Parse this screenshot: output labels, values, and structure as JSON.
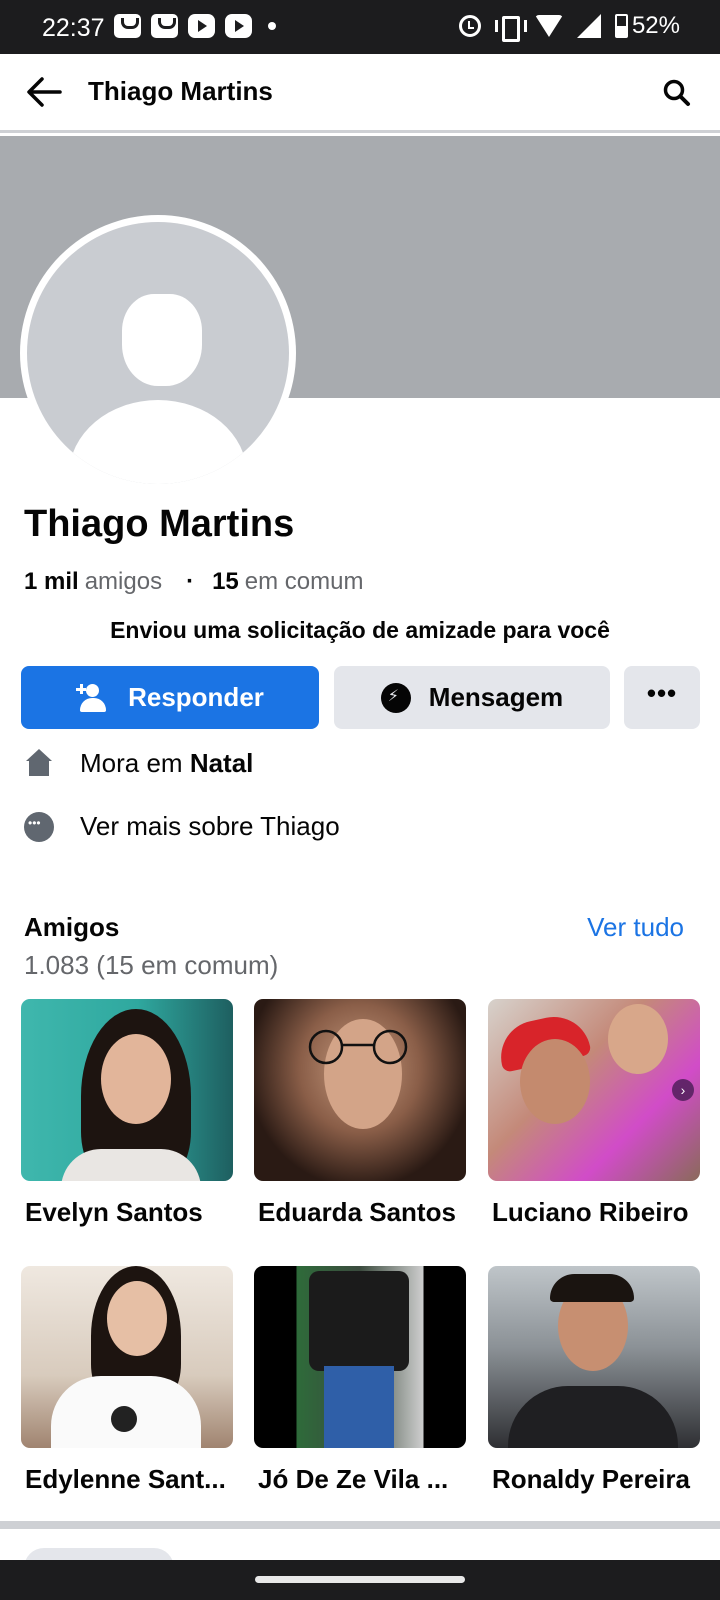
{
  "status_bar": {
    "time": "22:37",
    "battery": "52%",
    "icons": [
      "shopping-bag-icon",
      "shopping-bag-icon",
      "youtube-icon",
      "youtube-icon",
      "dot-icon",
      "alarm-icon",
      "vibrate-icon",
      "wifi-icon",
      "signal-icon",
      "battery-icon"
    ]
  },
  "header": {
    "title": "Thiago Martins"
  },
  "profile": {
    "name": "Thiago Martins",
    "friends_count": "1 mil",
    "friends_word": "amigos",
    "mutual_count": "15",
    "mutual_word": "em comum",
    "request_note": "Enviou uma solicitação de amizade para você"
  },
  "actions": {
    "respond": "Responder",
    "message": "Mensagem",
    "more": "•••"
  },
  "info": {
    "lives_prefix": "Mora em",
    "lives_city": "Natal",
    "see_more": "Ver mais sobre Thiago"
  },
  "friends": {
    "title": "Amigos",
    "see_all": "Ver tudo",
    "count": "1.083 (15 em comum)",
    "items": [
      {
        "name": "Evelyn Santos"
      },
      {
        "name": "Eduarda Santos"
      },
      {
        "name": "Luciano Ribeiro"
      },
      {
        "name": "Edylenne Sant..."
      },
      {
        "name": "Jó De Ze Vila ..."
      },
      {
        "name": "Ronaldy Pereira"
      }
    ]
  },
  "colors": {
    "accent": "#1b74e4",
    "button_gray": "#e4e6eb",
    "cover_gray": "#a8abaf"
  }
}
